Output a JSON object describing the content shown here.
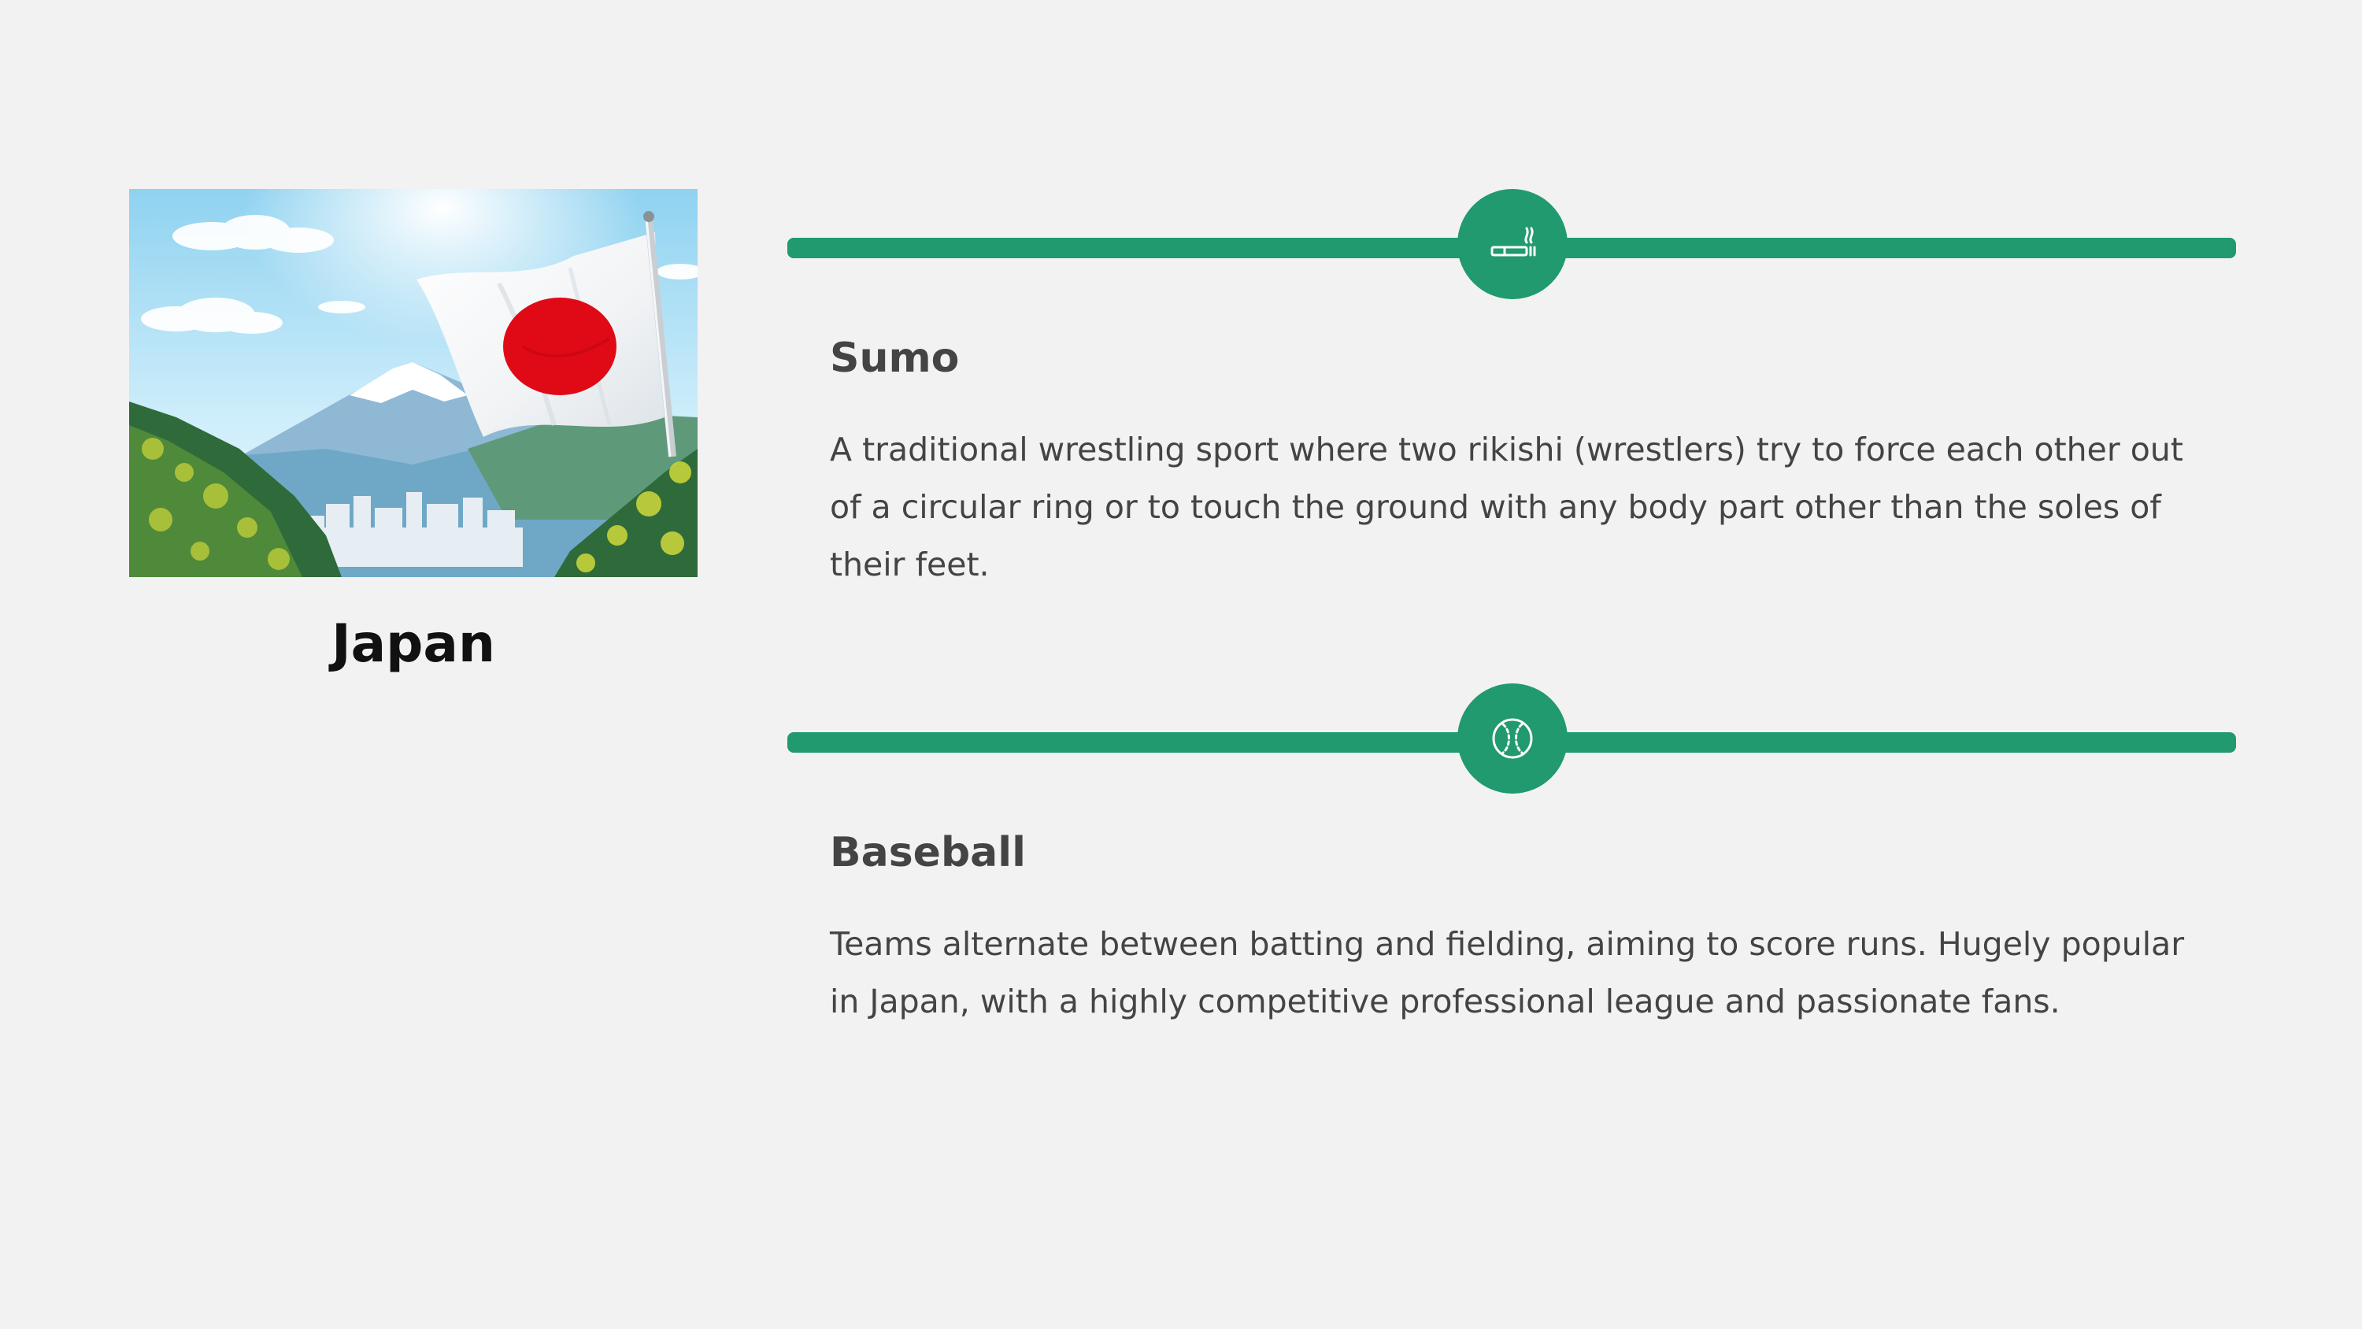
{
  "country": {
    "name": "Japan",
    "image_alt": "Japanese flag waving in front of Mount Fuji"
  },
  "colors": {
    "accent": "#209a6e",
    "background": "#f2f2f2",
    "heading": "#444444",
    "body_text": "#444444"
  },
  "sports": [
    {
      "name": "Sumo",
      "icon": "cigarette-icon",
      "description": "A traditional wrestling sport where two rikishi (wrestlers) try to force each other out of a circular ring or to touch the ground with any body part other than the soles of their feet."
    },
    {
      "name": "Baseball",
      "icon": "baseball-icon",
      "description": "Teams alternate between batting and fielding, aiming to score runs. Hugely popular in Japan, with a highly competitive professional league and passionate fans."
    }
  ]
}
